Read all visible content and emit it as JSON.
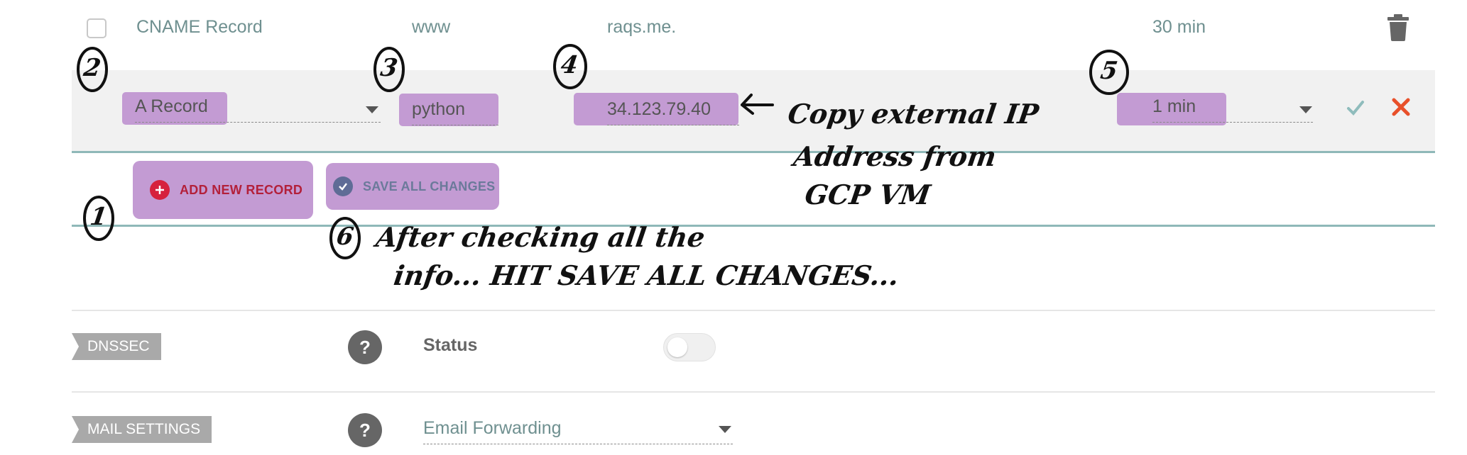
{
  "record_row": {
    "type": "CNAME Record",
    "host": "www",
    "value": "raqs.me.",
    "ttl": "30 min"
  },
  "edit_row": {
    "type": "A Record",
    "host": "python",
    "value": "34.123.79.40",
    "ttl": "1 min"
  },
  "actions": {
    "add_label": "ADD NEW RECORD",
    "save_label": "SAVE ALL CHANGES"
  },
  "dnssec": {
    "tag": "DNSSEC",
    "help": "?",
    "status_label": "Status",
    "toggle_on": false
  },
  "mail": {
    "tag": "MAIL SETTINGS",
    "help": "?",
    "selected": "Email Forwarding"
  },
  "annotations": {
    "step1": "1",
    "step2": "2",
    "step3": "3",
    "step4": "4",
    "step5": "5",
    "step6": "6",
    "note_ip_line1": "Copy external IP",
    "note_ip_line2": "Address from",
    "note_ip_line3": "GCP VM",
    "note_save_line1": "After checking all the",
    "note_save_line2": "info... HIT SAVE ALL CHANGES..."
  },
  "colors": {
    "highlight": "#c39bd3",
    "teal_border": "#8fb8b8",
    "cancel": "#e8502a",
    "confirm": "#8fbcbc"
  }
}
